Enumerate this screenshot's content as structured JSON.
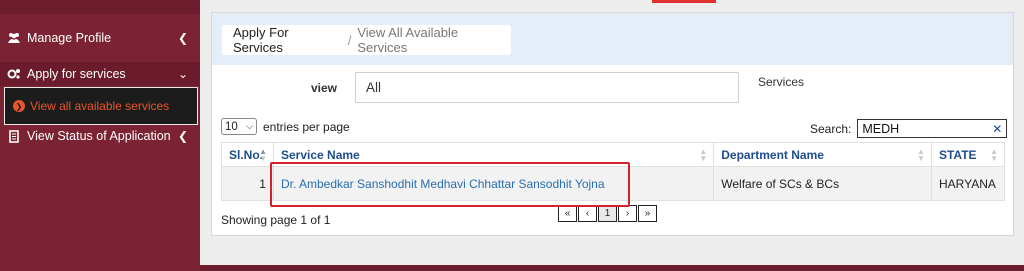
{
  "sidebar": {
    "items": [
      {
        "label": "Manage Profile",
        "icon": "users-icon"
      },
      {
        "label": "Apply for services",
        "icon": "gears-icon"
      },
      {
        "label": "View all available services",
        "icon": "circle-arrow-icon",
        "active": true
      },
      {
        "label": "View Status of Application",
        "icon": "document-icon"
      }
    ]
  },
  "breadcrumb": {
    "main": "Apply For Services",
    "separator": "/",
    "current": "View All Available Services"
  },
  "filters": {
    "view_label": "view",
    "view_value": "All",
    "services_label": "Services"
  },
  "table_controls": {
    "entries_value": "10",
    "entries_label": "entries per page",
    "search_label": "Search:",
    "search_value": "MEDH",
    "clear_glyph": "✕"
  },
  "table": {
    "columns": [
      "Sl.No.",
      "Service Name",
      "Department Name",
      "STATE"
    ],
    "rows": [
      {
        "slno": "1",
        "service": "Dr. Ambedkar Sanshodhit Medhavi Chhattar Sansodhit Yojna",
        "department": "Welfare of SCs & BCs",
        "state": "HARYANA"
      }
    ]
  },
  "footer": {
    "showing": "Showing page 1 of 1",
    "pager": [
      "«",
      "‹",
      "1",
      "›",
      "»"
    ]
  },
  "colors": {
    "sidebar_bg": "#7b2234",
    "active_item_text": "#e8562b",
    "link": "#2a6db0",
    "header_text": "#1f4e8c",
    "highlight": "#d2222d"
  }
}
